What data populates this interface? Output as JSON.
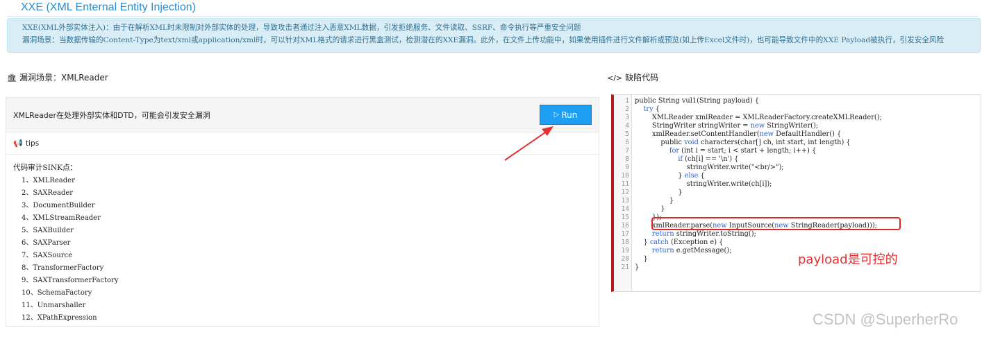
{
  "header": {
    "title": "XXE (XML Enternal Entity Injection)"
  },
  "alert": {
    "line1": "XXE(XML外部实体注入)：由于在解析XML时未限制对外部实体的处理，导致攻击者通过注入恶意XML数据，引发拒绝服务、文件读取、SSRF、命令执行等严重安全问题",
    "line2": "漏洞场景：当数据传输的Content-Type为text/xml或application/xml时，可以针对XML格式的请求进行黑盒测试，检测潜在的XXE漏洞。此外，在文件上传功能中，如果使用插件进行文件解析或预览(如上传Excel文件时)，也可能导致文件中的XXE Payload被执行，引发安全风险"
  },
  "left": {
    "section_title": "漏洞场景：XMLReader",
    "description": "XMLReader在处理外部实体和DTD，可能会引发安全漏洞",
    "run_label": "Run",
    "tips_label": "tips",
    "sink_title": "代码审计SINK点：",
    "sinks": [
      "1、XMLReader",
      "2、SAXReader",
      "3、DocumentBuilder",
      "4、XMLStreamReader",
      "5、SAXBuilder",
      "6、SAXParser",
      "7、SAXSource",
      "8、TransformerFactory",
      "9、SAXTransformerFactory",
      "10、SchemaFactory",
      "11、Unmarshaller",
      "12、XPathExpression"
    ]
  },
  "right": {
    "section_title": "缺陷代码",
    "line_numbers": [
      "1",
      "2",
      "3",
      "4",
      "5",
      "6",
      "7",
      "8",
      "9",
      "10",
      "11",
      "12",
      "13",
      "14",
      "15",
      "16",
      "17",
      "18",
      "19",
      "20",
      "21"
    ],
    "code_lines": [
      "public String vul1(String payload) {",
      "    try {",
      "        XMLReader xmlReader = XMLReaderFactory.createXMLReader();",
      "        StringWriter stringWriter = new StringWriter();",
      "        xmlReader.setContentHandler(new DefaultHandler() {",
      "            public void characters(char[] ch, int start, int length) {",
      "                for (int i = start; i < start + length; i++) {",
      "                    if (ch[i] == '\\n') {",
      "                        stringWriter.write(\"<br/>\");",
      "                    } else {",
      "                        stringWriter.write(ch[i]);",
      "                    }",
      "                }",
      "            }",
      "        });",
      "        xmlReader.parse(new InputSource(new StringReader(payload)));",
      "        return stringWriter.toString();",
      "    } catch (Exception e) {",
      "        return e.getMessage();",
      "    }",
      "}"
    ],
    "annotation": "payload是可控的"
  },
  "watermark": "CSDN @SuperherRo",
  "colors": {
    "title": "#2a8bd0",
    "alert_bg": "#d9edf7",
    "run_button": "#1e9ff2",
    "keyword": "#2b62c8",
    "code_border": "#b01c1c",
    "annotation": "#e03030"
  }
}
